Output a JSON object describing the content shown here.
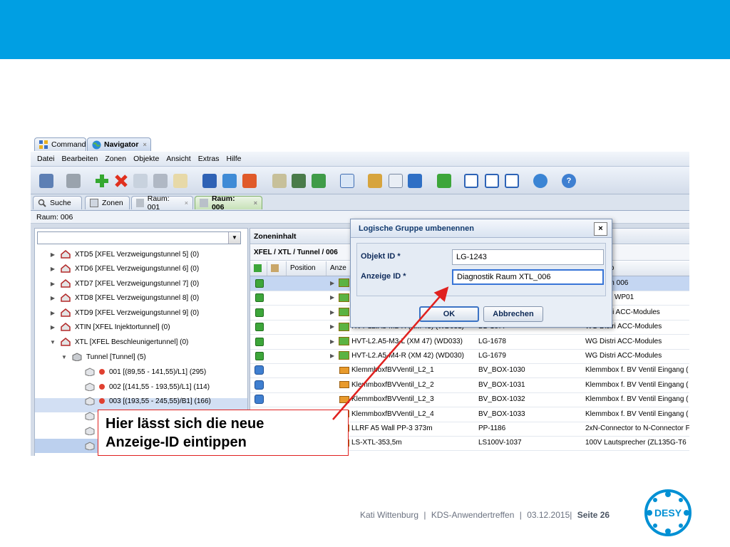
{
  "window_tabs": [
    {
      "label": "Command"
    },
    {
      "label": "Navigator",
      "close": "×"
    }
  ],
  "menu": [
    "Datei",
    "Bearbeiten",
    "Zonen",
    "Objekte",
    "Ansicht",
    "Extras",
    "Hilfe"
  ],
  "function_tabs": [
    {
      "label": "Suche"
    },
    {
      "label": "Zonen"
    },
    {
      "label": "Raum: 001",
      "close": "×"
    },
    {
      "label": "Raum: 006",
      "close": "×"
    }
  ],
  "current_room": "Raum: 006",
  "tree": [
    {
      "label": "XTD5 [XFEL Verzweigungstunnel 5] (0)",
      "toggle": "▶"
    },
    {
      "label": "XTD6 [XFEL Verzweigungstunnel 6] (0)",
      "toggle": "▶"
    },
    {
      "label": "XTD7 [XFEL Verzweigungstunnel 7] (0)",
      "toggle": "▶"
    },
    {
      "label": "XTD8 [XFEL Verzweigungstunnel 8] (0)",
      "toggle": "▶"
    },
    {
      "label": "XTD9 [XFEL Verzweigungstunnel 9] (0)",
      "toggle": "▶"
    },
    {
      "label": "XTIN [XFEL Injektortunnel] (0)",
      "toggle": "▶"
    },
    {
      "label": "XTL [XFEL Beschleunigertunnel] (0)",
      "toggle": "▼"
    },
    {
      "label": "Tunnel [Tunnel] (5)",
      "toggle": "▼"
    },
    {
      "label": "001 [(89,55 - 141,55)/L1] (295)"
    },
    {
      "label": "002 [(141,55 - 193,55)/L1] (114)"
    },
    {
      "label": "003 [(193,55 - 245,55)/B1] (166)"
    }
  ],
  "zone": {
    "header": "Zoneninhalt",
    "path": "XFEL / XTL / Tunnel / 006",
    "columns": [
      "Position",
      "Anze",
      "typ"
    ],
    "rows": [
      {
        "anzeige": "",
        "objekt": "",
        "typ": "um 006",
        "icon": "green-cube",
        "expander": "▶",
        "selected": true
      },
      {
        "anzeige": "",
        "objekt": "",
        "typ": "on WP01",
        "icon": "green-cube",
        "expander": "▶"
      },
      {
        "anzeige": "",
        "objekt": "",
        "typ": "stri ACC-Modules",
        "icon": "green-cube",
        "expander": "▶"
      },
      {
        "anzeige": "HVT-L2.A5-M2-R (XM 43) (WD031)",
        "objekt": "LG-1677",
        "typ": "WG Distri ACC-Modules",
        "icon": "green-cube",
        "expander": "▶"
      },
      {
        "anzeige": "HVT-L2.A5-M3-L (XM 47) (WD033)",
        "objekt": "LG-1678",
        "typ": "WG Distri ACC-Modules",
        "icon": "green-cube",
        "expander": "▶"
      },
      {
        "anzeige": "HVT-L2.A5-M4-R (XM 42) (WD030)",
        "objekt": "LG-1679",
        "typ": "WG Distri ACC-Modules",
        "icon": "green-cube",
        "expander": "▶"
      },
      {
        "anzeige": "KlemmboxfBVVentil_L2_1",
        "objekt": "BV_BOX-1030",
        "typ": "Klemmbox f. BV Ventil Eingang (",
        "icon": "blue-device"
      },
      {
        "anzeige": "KlemmboxfBVVentil_L2_2",
        "objekt": "BV_BOX-1031",
        "typ": "Klemmbox f. BV Ventil Eingang (",
        "icon": "blue-device"
      },
      {
        "anzeige": "KlemmboxfBVVentil_L2_3",
        "objekt": "BV_BOX-1032",
        "typ": "Klemmbox f. BV Ventil Eingang (",
        "icon": "blue-device"
      },
      {
        "anzeige": "KlemmboxfBVVentil_L2_4",
        "objekt": "BV_BOX-1033",
        "typ": "Klemmbox f. BV Ventil Eingang (",
        "icon": "blue-device"
      },
      {
        "anzeige": "LLRF A5 Wall PP-3 373m",
        "objekt": "PP-1186",
        "typ": "2xN-Connector to N-Connector F",
        "icon": "blue-device"
      },
      {
        "anzeige": "LS-XTL-353,5m",
        "objekt": "LS100V-1037",
        "typ": "100V Lautsprecher (ZL135G-T6",
        "icon": "blue-device"
      }
    ]
  },
  "dialog": {
    "title": "Logische Gruppe umbenennen",
    "close": "×",
    "fields": [
      {
        "label": "Objekt ID *",
        "value": "LG-1243"
      },
      {
        "label": "Anzeige ID *",
        "value": "Diagnostik Raum XTL_006"
      }
    ],
    "ok": "OK",
    "cancel": "Abbrechen"
  },
  "callout": {
    "line1": "Hier lässt sich die neue",
    "line2": "Anzeige-ID eintippen"
  },
  "footer": {
    "author": "Kati Wittenburg",
    "sep1": "|",
    "event": "KDS-Anwendertreffen",
    "sep2": "|",
    "date": "03.12.2015|",
    "page": "Seite 26"
  },
  "logo_text": "DESY",
  "colors": {
    "top_bar": "#009fe3",
    "callout_border": "#e0211f",
    "selection": "#c4d6f2",
    "active_tab": "#c7e2b8"
  }
}
